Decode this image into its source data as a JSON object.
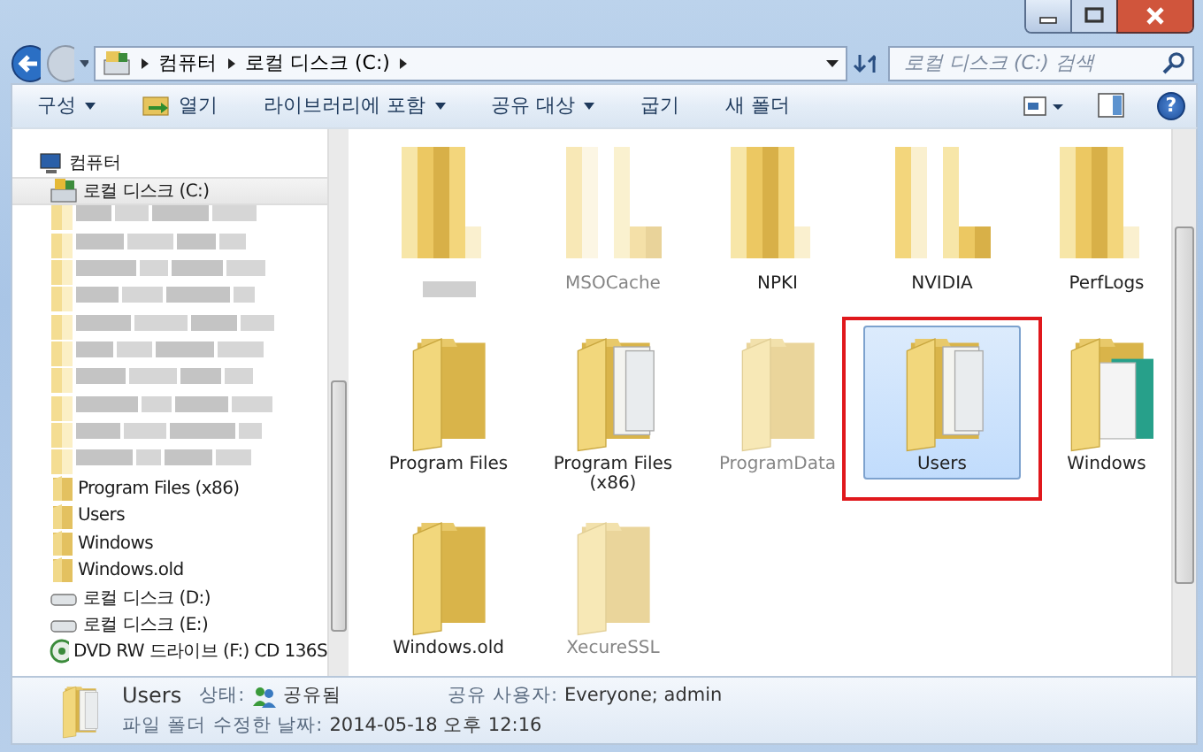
{
  "address": {
    "path": [
      "컴퓨터",
      "로컬 디스크 (C:)"
    ],
    "search_placeholder": "로컬 디스크 (C:) 검색"
  },
  "toolbar": [
    {
      "label": "구성",
      "kind": "menu"
    },
    {
      "label": "열기",
      "kind": "open"
    },
    {
      "label": "라이브러리에 포함",
      "kind": "menu"
    },
    {
      "label": "공유 대상",
      "kind": "menu"
    },
    {
      "label": "굽기",
      "kind": "action"
    },
    {
      "label": "새 폴더",
      "kind": "action"
    }
  ],
  "help_label": "?",
  "nav_pane": {
    "items": [
      {
        "label": "컴퓨터",
        "kind": "computer",
        "selected": false,
        "children": [
          {
            "label": "로컬 디스크 (C:)",
            "kind": "system-drive",
            "selected": true,
            "children": [
              {
                "kind": "blurred",
                "selected": false
              },
              {
                "kind": "blurred",
                "selected": false
              },
              {
                "kind": "blurred",
                "selected": false
              },
              {
                "kind": "blurred",
                "selected": false
              },
              {
                "kind": "blurred",
                "selected": false
              },
              {
                "kind": "blurred",
                "selected": false
              },
              {
                "kind": "blurred",
                "selected": false
              },
              {
                "kind": "blurred",
                "selected": false
              },
              {
                "kind": "blurred",
                "selected": false
              },
              {
                "kind": "blurred",
                "selected": false
              },
              {
                "label": "Program Files (x86)",
                "kind": "folder",
                "selected": false
              },
              {
                "label": "Users",
                "kind": "folder",
                "selected": false
              },
              {
                "label": "Windows",
                "kind": "folder",
                "selected": false
              },
              {
                "label": "Windows.old",
                "kind": "folder",
                "selected": false
              }
            ]
          },
          {
            "label": "로컬 디스크 (D:)",
            "kind": "drive",
            "selected": false
          },
          {
            "label": "로컬 디스크 (E:)",
            "kind": "drive",
            "selected": false
          },
          {
            "label": "DVD RW 드라이브 (F:) CD 136S",
            "kind": "dvd",
            "selected": false
          }
        ]
      }
    ]
  },
  "files": [
    {
      "kind": "blurred",
      "hidden": false,
      "selected": false,
      "highlighted": false
    },
    {
      "label": "MSOCache",
      "kind": "blurred",
      "hidden": true,
      "selected": false,
      "highlighted": false
    },
    {
      "label": "NPKI",
      "kind": "blurred",
      "hidden": false,
      "selected": false,
      "highlighted": false
    },
    {
      "label": "NVIDIA",
      "kind": "blurred",
      "hidden": false,
      "selected": false,
      "highlighted": false
    },
    {
      "label": "PerfLogs",
      "kind": "blurred",
      "hidden": false,
      "selected": false,
      "highlighted": false
    },
    {
      "label": "Program Files",
      "kind": "plain",
      "hidden": false,
      "selected": false,
      "highlighted": false
    },
    {
      "label": "Program Files (x86)",
      "kind": "documents",
      "hidden": false,
      "selected": false,
      "highlighted": false
    },
    {
      "label": "ProgramData",
      "kind": "plain",
      "hidden": true,
      "selected": false,
      "highlighted": false
    },
    {
      "label": "Users",
      "kind": "documents",
      "hidden": false,
      "selected": true,
      "highlighted": true
    },
    {
      "label": "Windows",
      "kind": "app",
      "hidden": false,
      "selected": false,
      "highlighted": false
    },
    {
      "label": "Windows.old",
      "kind": "plain",
      "hidden": false,
      "selected": false,
      "highlighted": false
    },
    {
      "label": "XecureSSL",
      "kind": "plain",
      "hidden": true,
      "selected": false,
      "highlighted": false
    }
  ],
  "status_bar": {
    "name": "Users",
    "state_label": "상태:",
    "state_value": "공유됨",
    "shared_label": "공유 사용자:",
    "shared_value": "Everyone; admin",
    "type": "파일 폴더",
    "modified_label": "수정한 날짜:",
    "modified_value": "2014-05-18 오후 12:16"
  }
}
